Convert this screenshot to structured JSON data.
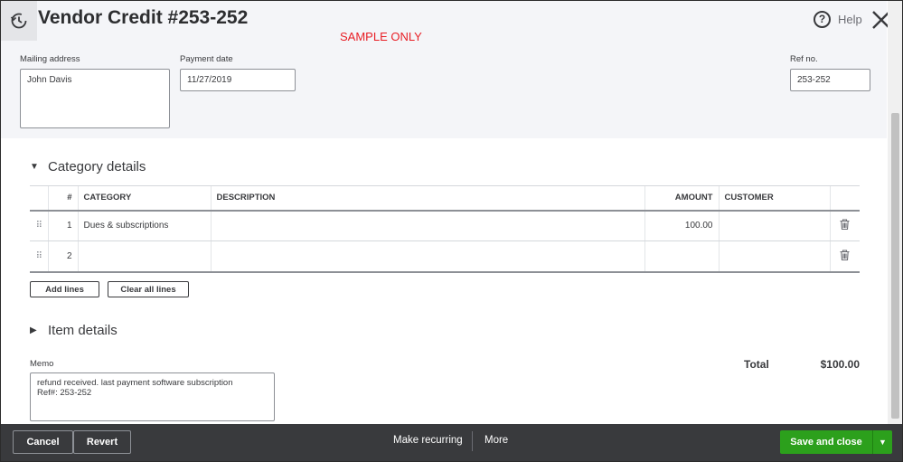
{
  "header": {
    "title": "Vendor Credit #253-252",
    "watermark": "SAMPLE ONLY",
    "help_label": "Help",
    "help_glyph": "?"
  },
  "form": {
    "mailing_address_label": "Mailing address",
    "mailing_address_value": "John Davis",
    "payment_date_label": "Payment date",
    "payment_date_value": "11/27/2019",
    "ref_no_label": "Ref no.",
    "ref_no_value": "253-252"
  },
  "category_details": {
    "title": "Category details",
    "columns": [
      "#",
      "CATEGORY",
      "DESCRIPTION",
      "AMOUNT",
      "CUSTOMER"
    ],
    "rows": [
      {
        "num": "1",
        "category": "Dues & subscriptions",
        "description": "",
        "amount": "100.00",
        "customer": ""
      },
      {
        "num": "2",
        "category": "",
        "description": "",
        "amount": "",
        "customer": ""
      }
    ],
    "add_lines_label": "Add lines",
    "clear_all_lines_label": "Clear all lines"
  },
  "item_details": {
    "title": "Item details"
  },
  "memo": {
    "label": "Memo",
    "value": "refund received. last payment software subscription\nRef#: 253-252"
  },
  "totals": {
    "total_label": "Total",
    "total_value": "$100.00"
  },
  "footer": {
    "cancel_label": "Cancel",
    "revert_label": "Revert",
    "make_recurring_label": "Make recurring",
    "more_label": "More",
    "save_and_close_label": "Save and close"
  },
  "colors": {
    "primary_green": "#2ca01c",
    "footer_bg": "#393a3d",
    "watermark_red": "#e81e25",
    "header_band": "#f4f5f8"
  },
  "icons": [
    "history-icon",
    "help-icon",
    "close-icon",
    "drag-handle-icon",
    "trash-icon",
    "collapse-triangle-icon",
    "expand-triangle-icon",
    "dropdown-arrow-icon"
  ]
}
